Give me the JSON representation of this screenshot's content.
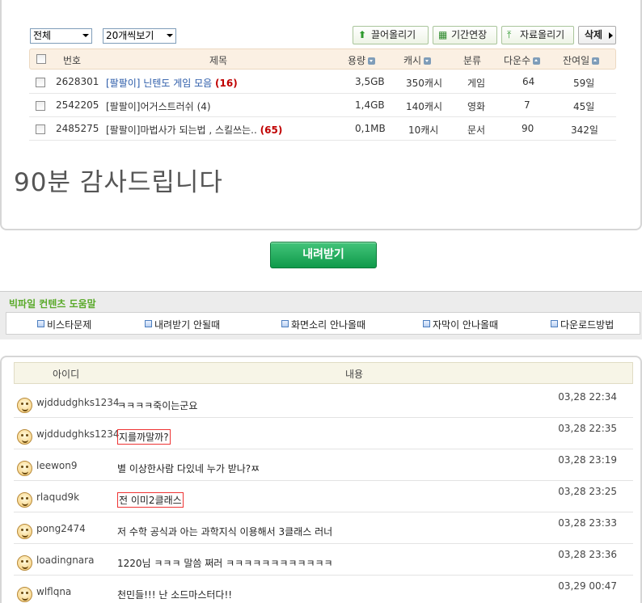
{
  "filters": {
    "category": "전체",
    "per_page": "20개씩보기"
  },
  "toolbar": {
    "bump": "끌어올리기",
    "extend": "기간연장",
    "upload": "자료올리기",
    "delete": "삭제"
  },
  "file_table": {
    "headers": {
      "no": "번호",
      "title": "제목",
      "size": "용량",
      "cash": "캐시",
      "category": "분류",
      "downloads": "다운수",
      "remaining": "잔여일"
    },
    "rows": [
      {
        "no": "2628301",
        "title": "[팔팔이] 닌텐도 게임 모음",
        "count": "(16)",
        "size": "3,5GB",
        "cash": "350캐시",
        "category": "게임",
        "downloads": "64",
        "remaining": "59일"
      },
      {
        "no": "2542205",
        "title": "[팔팔이]어거스트러쉬",
        "count": "(4)",
        "size": "1,4GB",
        "cash": "140캐시",
        "category": "영화",
        "downloads": "7",
        "remaining": "45일"
      },
      {
        "no": "2485275",
        "title": "[팔팔이]마법사가 되는법 , 스킬쓰는..",
        "count": "(65)",
        "size": "0,1MB",
        "cash": "10캐시",
        "category": "문서",
        "downloads": "90",
        "remaining": "342일"
      }
    ]
  },
  "message": "90분 감사드립니다",
  "download_button": "내려받기",
  "help": {
    "title": "빅파일 컨텐츠 도움말",
    "links": [
      "비스타문제",
      "내려받기 안될때",
      "화면소리 안나올때",
      "자막이 안나올때",
      "다운로드방법"
    ]
  },
  "comments": {
    "headers": {
      "id": "아이디",
      "content": "내용"
    },
    "rows": [
      {
        "id": "wjddudghks1234",
        "text": "ㅋㅋㅋㅋ죽이는군요",
        "time": "03,28 22:34",
        "boxed": false
      },
      {
        "id": "wjddudghks1234",
        "text": "지를까말까?",
        "time": "03,28 22:35",
        "boxed": true
      },
      {
        "id": "leewon9",
        "text": "별 이상한사람 다있네 누가 받나?ㅉ",
        "time": "03,28 23:19",
        "boxed": false
      },
      {
        "id": "rlaqud9k",
        "text": "전 이미2클래스",
        "time": "03,28 23:25",
        "boxed": true
      },
      {
        "id": "pong2474",
        "text": "저 수학 공식과 아는 과학지식 이용해서 3클래스 러너",
        "time": "03,28 23:33",
        "boxed": false
      },
      {
        "id": "loadingnara",
        "text": "1220님 ㅋㅋㅋ 말씀 쩌러 ㅋㅋㅋㅋㅋㅋㅋㅋㅋㅋㅋㅋ",
        "time": "03,28 23:36",
        "boxed": false
      },
      {
        "id": "wlflqna",
        "text": "천민들!!! 난 소드마스터다!!",
        "time": "03,29 00:47",
        "boxed": false
      }
    ]
  }
}
